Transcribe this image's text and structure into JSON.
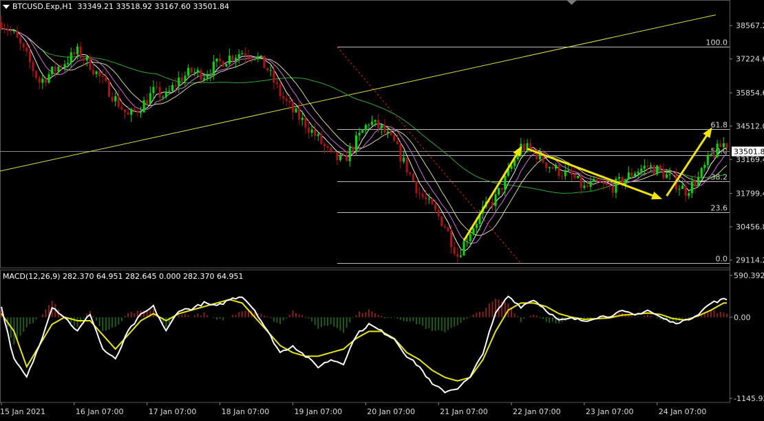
{
  "header": {
    "symbol": "BTCUSD.Exp,H1",
    "ohlc": "33349.21 33518.92 33167.60 33501.84",
    "macd": "MACD(12,26,9) 282.370 64.951 282.645 0.000 282.370 64.951"
  },
  "chart_data": [
    {
      "type": "candlestick",
      "price_axis": {
        "ticks": [
          "38567.2",
          "37224.6",
          "35854.6",
          "34512.0",
          "33169.4",
          "31799.4",
          "30456.8",
          "29114.2"
        ],
        "range": [
          28800,
          39100
        ]
      },
      "time_axis": [
        "15 Jan 2021",
        "16 Jan 07:00",
        "17 Jan 07:00",
        "18 Jan 07:00",
        "19 Jan 07:00",
        "20 Jan 07:00",
        "21 Jan 07:00",
        "22 Jan 07:00",
        "23 Jan 07:00",
        "24 Jan 07:00"
      ],
      "current_price": "33501.8",
      "fibonacci": {
        "high": 37710,
        "low": 28980,
        "levels": [
          {
            "label": "100.0",
            "value": 37710
          },
          {
            "label": "61.8",
            "value": 34380
          },
          {
            "label": "50.0",
            "value": 33340
          },
          {
            "label": "38.2",
            "value": 32300
          },
          {
            "label": "23.6",
            "value": 31040
          },
          {
            "label": "0.0",
            "value": 28980
          }
        ]
      },
      "path": [
        [
          0,
          38700
        ],
        [
          4,
          38200
        ],
        [
          8,
          37300
        ],
        [
          12,
          36300
        ],
        [
          16,
          36700
        ],
        [
          20,
          37100
        ],
        [
          24,
          37500
        ],
        [
          28,
          37000
        ],
        [
          32,
          36300
        ],
        [
          36,
          35600
        ],
        [
          40,
          34900
        ],
        [
          44,
          35300
        ],
        [
          48,
          35900
        ],
        [
          52,
          35700
        ],
        [
          56,
          36400
        ],
        [
          60,
          36700
        ],
        [
          64,
          36600
        ],
        [
          68,
          37000
        ],
        [
          72,
          37300
        ],
        [
          76,
          37500
        ],
        [
          80,
          37400
        ],
        [
          84,
          36800
        ],
        [
          88,
          35800
        ],
        [
          92,
          35100
        ],
        [
          96,
          34600
        ],
        [
          100,
          34000
        ],
        [
          104,
          33300
        ],
        [
          108,
          33100
        ],
        [
          112,
          33900
        ],
        [
          116,
          34700
        ],
        [
          120,
          34400
        ],
        [
          124,
          33800
        ],
        [
          128,
          32800
        ],
        [
          132,
          31800
        ],
        [
          136,
          31200
        ],
        [
          140,
          30500
        ],
        [
          144,
          29300
        ],
        [
          148,
          30300
        ],
        [
          152,
          31100
        ],
        [
          156,
          31600
        ],
        [
          160,
          32600
        ],
        [
          164,
          33700
        ],
        [
          168,
          33500
        ],
        [
          172,
          33000
        ],
        [
          176,
          32700
        ],
        [
          180,
          32500
        ],
        [
          184,
          32000
        ],
        [
          188,
          32200
        ],
        [
          192,
          32000
        ],
        [
          196,
          32300
        ],
        [
          200,
          32700
        ],
        [
          204,
          32900
        ],
        [
          208,
          32700
        ],
        [
          212,
          32300
        ],
        [
          216,
          31900
        ],
        [
          220,
          32400
        ],
        [
          224,
          33300
        ],
        [
          228,
          33800
        ]
      ]
    },
    {
      "type": "macd",
      "params": "12,26,9",
      "axis": {
        "ticks": [
          "590.392",
          "0.00",
          "-1145.92"
        ],
        "range": [
          -1145.92,
          590.392
        ]
      },
      "macd_path": [
        [
          0,
          150
        ],
        [
          4,
          -600
        ],
        [
          8,
          -850
        ],
        [
          12,
          -400
        ],
        [
          16,
          150
        ],
        [
          20,
          0
        ],
        [
          24,
          -200
        ],
        [
          28,
          50
        ],
        [
          32,
          -450
        ],
        [
          36,
          -600
        ],
        [
          40,
          -200
        ],
        [
          44,
          30
        ],
        [
          48,
          150
        ],
        [
          52,
          -200
        ],
        [
          56,
          100
        ],
        [
          60,
          120
        ],
        [
          64,
          200
        ],
        [
          68,
          150
        ],
        [
          72,
          250
        ],
        [
          76,
          300
        ],
        [
          80,
          100
        ],
        [
          84,
          -200
        ],
        [
          88,
          -500
        ],
        [
          92,
          -400
        ],
        [
          96,
          -550
        ],
        [
          100,
          -700
        ],
        [
          104,
          -600
        ],
        [
          108,
          -650
        ],
        [
          112,
          -250
        ],
        [
          116,
          -100
        ],
        [
          120,
          -200
        ],
        [
          124,
          -300
        ],
        [
          128,
          -550
        ],
        [
          132,
          -700
        ],
        [
          136,
          -950
        ],
        [
          140,
          -1050
        ],
        [
          144,
          -1000
        ],
        [
          148,
          -850
        ],
        [
          152,
          -500
        ],
        [
          156,
          50
        ],
        [
          160,
          300
        ],
        [
          164,
          150
        ],
        [
          168,
          250
        ],
        [
          172,
          100
        ],
        [
          176,
          -50
        ],
        [
          180,
          -20
        ],
        [
          184,
          -50
        ],
        [
          188,
          0
        ],
        [
          192,
          20
        ],
        [
          196,
          80
        ],
        [
          200,
          30
        ],
        [
          204,
          100
        ],
        [
          208,
          0
        ],
        [
          212,
          -80
        ],
        [
          216,
          -50
        ],
        [
          220,
          50
        ],
        [
          224,
          200
        ],
        [
          228,
          250
        ]
      ],
      "signal_path": [
        [
          0,
          50
        ],
        [
          4,
          -200
        ],
        [
          8,
          -700
        ],
        [
          12,
          -400
        ],
        [
          16,
          -100
        ],
        [
          20,
          0
        ],
        [
          24,
          -50
        ],
        [
          28,
          -50
        ],
        [
          32,
          -250
        ],
        [
          36,
          -450
        ],
        [
          40,
          -250
        ],
        [
          44,
          -50
        ],
        [
          48,
          50
        ],
        [
          52,
          -50
        ],
        [
          56,
          50
        ],
        [
          60,
          100
        ],
        [
          64,
          150
        ],
        [
          68,
          200
        ],
        [
          72,
          250
        ],
        [
          76,
          200
        ],
        [
          80,
          0
        ],
        [
          84,
          -200
        ],
        [
          88,
          -400
        ],
        [
          92,
          -500
        ],
        [
          96,
          -550
        ],
        [
          100,
          -550
        ],
        [
          104,
          -500
        ],
        [
          108,
          -450
        ],
        [
          112,
          -300
        ],
        [
          116,
          -200
        ],
        [
          120,
          -200
        ],
        [
          124,
          -300
        ],
        [
          128,
          -500
        ],
        [
          132,
          -600
        ],
        [
          136,
          -750
        ],
        [
          140,
          -850
        ],
        [
          144,
          -900
        ],
        [
          148,
          -850
        ],
        [
          152,
          -600
        ],
        [
          156,
          -200
        ],
        [
          160,
          100
        ],
        [
          164,
          200
        ],
        [
          168,
          200
        ],
        [
          172,
          150
        ],
        [
          176,
          50
        ],
        [
          180,
          0
        ],
        [
          184,
          -30
        ],
        [
          188,
          -20
        ],
        [
          192,
          -10
        ],
        [
          196,
          30
        ],
        [
          200,
          40
        ],
        [
          204,
          60
        ],
        [
          208,
          40
        ],
        [
          212,
          -20
        ],
        [
          216,
          -40
        ],
        [
          220,
          20
        ],
        [
          224,
          100
        ],
        [
          228,
          200
        ]
      ]
    }
  ],
  "colors": {
    "background": "#000000",
    "bull_candle": "#00e000",
    "bear_candle": "#b01010",
    "ma_green": "#2ea62e",
    "ma_white": "#f0f0f0",
    "ma_pink": "#d070e0",
    "ma_khaki": "#d8d890",
    "trendline": "#e0e040",
    "arrow": "#f2e600",
    "fib": "#bdbdbd",
    "fib_diagonal": "#cc2222",
    "macd_line": "#ffffff",
    "signal_line": "#e8e800",
    "hist_pos": "#8b1f1f",
    "hist_neg": "#1f5c1f"
  }
}
